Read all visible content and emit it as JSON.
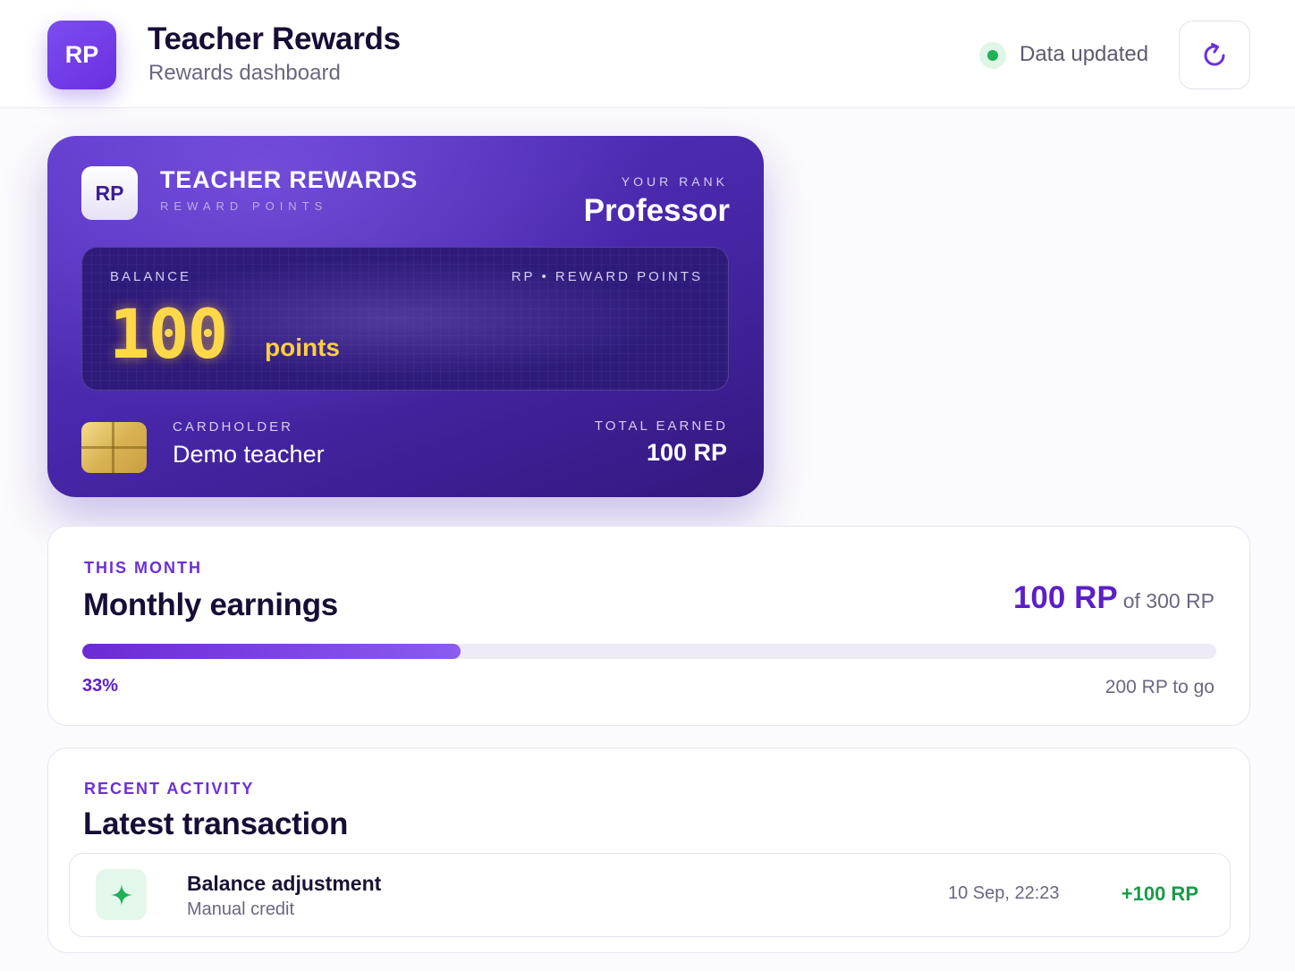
{
  "header": {
    "logo_text": "RP",
    "title": "Teacher Rewards",
    "subtitle": "Rewards dashboard",
    "status_text": "Data updated",
    "refresh_icon": "refresh-icon"
  },
  "card": {
    "logo_text": "RP",
    "brand": "TEACHER REWARDS",
    "brand_sub": "REWARD POINTS",
    "rank_label": "YOUR RANK",
    "rank_value": "Professor",
    "balance_label": "BALANCE",
    "balance_unit": "RP • REWARD POINTS",
    "balance_value": "100",
    "balance_points_label": "points",
    "cardholder_label": "CARDHOLDER",
    "cardholder_name": "Demo teacher",
    "total_earned_label": "TOTAL EARNED",
    "total_earned_value": "100 RP"
  },
  "monthly": {
    "eyebrow": "THIS MONTH",
    "title": "Monthly earnings",
    "value": "100 RP",
    "goal_text": "of 300 RP",
    "progress_fraction": 0.3333,
    "percent_text": "33%",
    "remaining_text": "200 RP to go"
  },
  "activity": {
    "eyebrow": "RECENT ACTIVITY",
    "title": "Latest transaction",
    "transactions": [
      {
        "icon": "sparkle-icon",
        "title": "Balance adjustment",
        "subtitle": "Manual credit",
        "date": "10 Sep, 22:23",
        "amount": "+100 RP"
      }
    ]
  },
  "colors": {
    "accent": "#6d2fd8",
    "card_primary": "#4626a6",
    "balance_gold": "#ffd84a",
    "positive": "#1a9a4a",
    "status_ok": "#1fb05a"
  }
}
